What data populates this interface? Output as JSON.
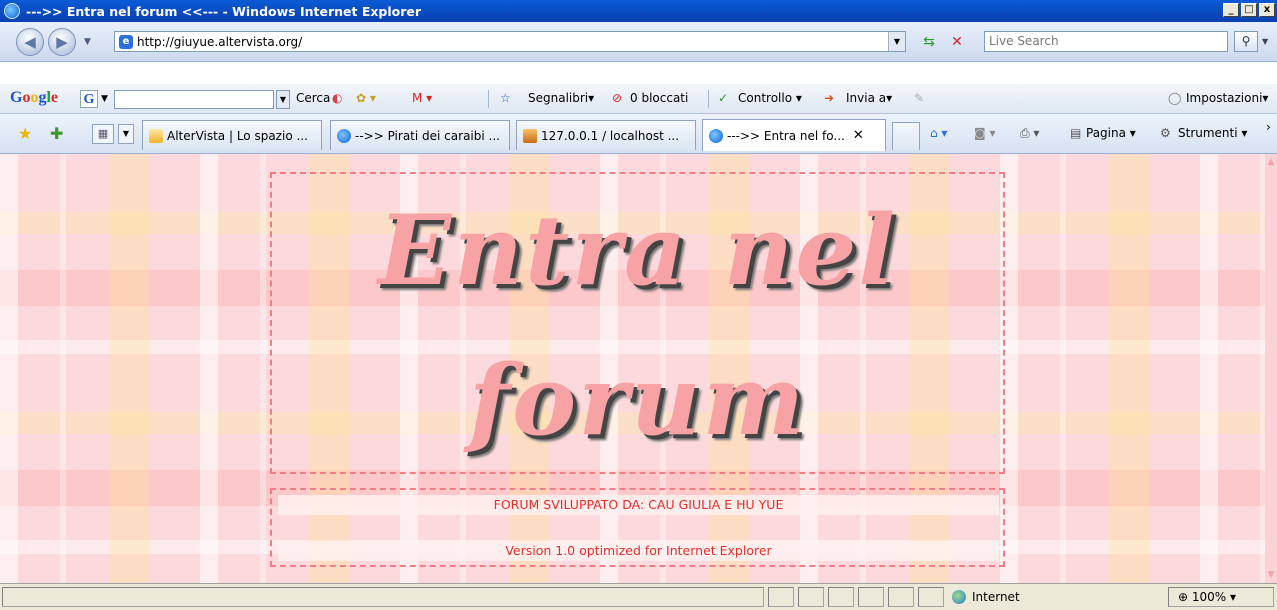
{
  "window": {
    "title": "--->> Entra nel forum <<--- - Windows Internet Explorer",
    "controls": [
      "_",
      "□",
      "x"
    ]
  },
  "address_bar": {
    "back_glyph": "◀",
    "forward_glyph": "▶",
    "url": "http://giuyue.altervista.org/",
    "search_placeholder": "Live Search"
  },
  "google_toolbar": {
    "logo": [
      "G",
      "o",
      "o",
      "g",
      "l",
      "e"
    ],
    "search_button": "Cerca",
    "gmail": "M ▾",
    "bookmarks": "Segnalibri▾",
    "popups_blocked": "0 bloccati",
    "spellcheck": "Controllo ▾",
    "send_to": "Invia a▾",
    "settings": "Impostazioni▾"
  },
  "tabs": [
    {
      "label": "AlterVista | Lo spazio ...",
      "icon": "altervista-icon",
      "active": false
    },
    {
      "label": "-->> Pirati dei caraibi ...",
      "icon": "ie-icon",
      "active": false
    },
    {
      "label": "127.0.0.1 / localhost ...",
      "icon": "phpmyadmin-icon",
      "active": false
    },
    {
      "label": "--->> Entra nel fo...",
      "icon": "ie-icon",
      "active": true
    }
  ],
  "command_bar": {
    "page": "Pagina ▾",
    "tools": "Strumenti ▾"
  },
  "page": {
    "heading_line1": "Entra nel",
    "heading_line2": "forum",
    "credits": "FORUM SVILUPPATO DA: CAU GIULIA E HU YUE",
    "version": "Version 1.0 optimized for Internet Explorer"
  },
  "status_bar": {
    "zone": "Internet",
    "zoom": "100%"
  },
  "colors": {
    "title_bar": "#0b4fc8",
    "heading": "#f7a3a5",
    "info_text": "#e0312e",
    "frame_dash": "#f27d86"
  }
}
